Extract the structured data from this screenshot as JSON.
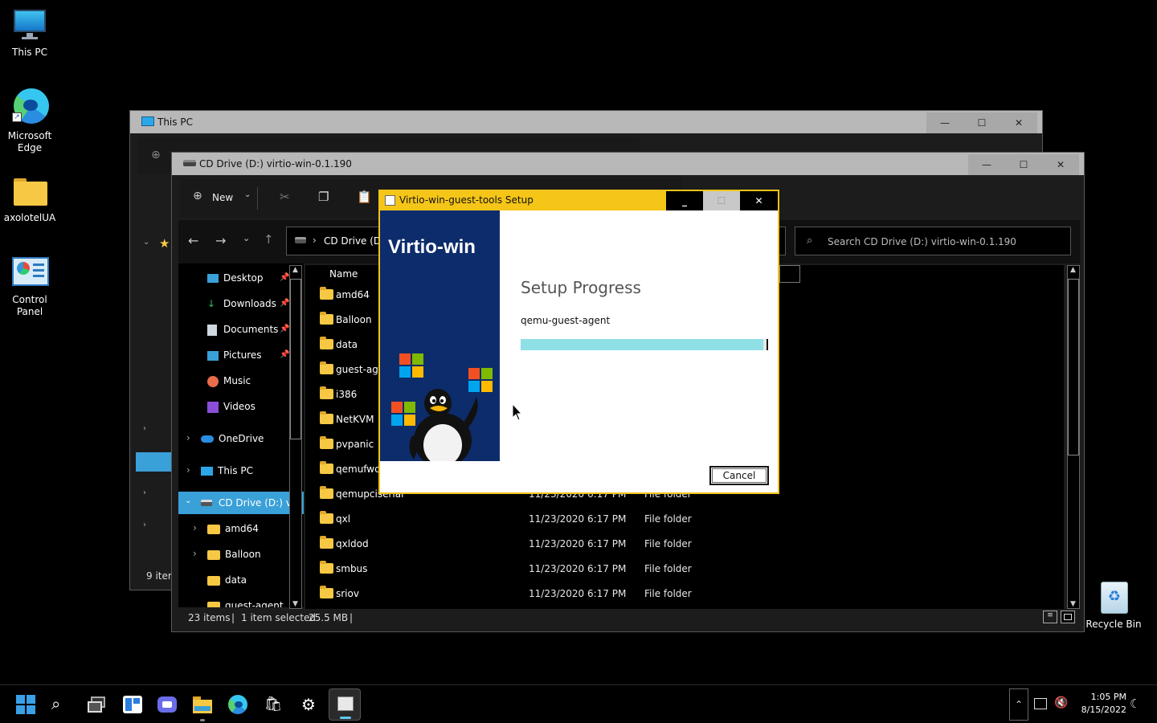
{
  "desktop": {
    "icons": [
      {
        "label": "This PC",
        "icon": "monitor-icon"
      },
      {
        "label": "Microsoft Edge",
        "icon": "edge-icon"
      },
      {
        "label": "axolotelUA",
        "icon": "folder-icon"
      },
      {
        "label": "Control Panel",
        "icon": "control-panel-icon"
      },
      {
        "label": "Recycle Bin",
        "icon": "recycle-bin-icon"
      }
    ]
  },
  "back_window": {
    "title": "This PC",
    "status": "9 item"
  },
  "explorer": {
    "title": "CD Drive (D:) virtio-win-0.1.190",
    "toolbar": {
      "new_label": "New"
    },
    "address": {
      "crumb": "CD Drive (D:)"
    },
    "search": {
      "placeholder": "Search CD Drive (D:) virtio-win-0.1.190"
    },
    "nav": {
      "quick_access": [
        {
          "label": "Desktop"
        },
        {
          "label": "Downloads"
        },
        {
          "label": "Documents"
        },
        {
          "label": "Pictures"
        },
        {
          "label": "Music"
        },
        {
          "label": "Videos"
        }
      ],
      "onedrive": "OneDrive",
      "this_pc": "This PC",
      "cd_drive": "CD Drive (D:) virt",
      "subfolders": [
        "amd64",
        "Balloon",
        "data",
        "guest-agent"
      ]
    },
    "column_name": "Name",
    "files": [
      {
        "name": "amd64",
        "date": "",
        "type": ""
      },
      {
        "name": "Balloon",
        "date": "",
        "type": ""
      },
      {
        "name": "data",
        "date": "",
        "type": ""
      },
      {
        "name": "guest-age",
        "date": "",
        "type": ""
      },
      {
        "name": "i386",
        "date": "",
        "type": ""
      },
      {
        "name": "NetKVM",
        "date": "",
        "type": ""
      },
      {
        "name": "pvpanic",
        "date": "",
        "type": ""
      },
      {
        "name": "qemufwc",
        "date": "",
        "type": ""
      },
      {
        "name": "qemupciserial",
        "date": "11/23/2020 6:17 PM",
        "type": "File folder"
      },
      {
        "name": "qxl",
        "date": "11/23/2020 6:17 PM",
        "type": "File folder"
      },
      {
        "name": "qxldod",
        "date": "11/23/2020 6:17 PM",
        "type": "File folder"
      },
      {
        "name": "smbus",
        "date": "11/23/2020 6:17 PM",
        "type": "File folder"
      },
      {
        "name": "sriov",
        "date": "11/23/2020 6:17 PM",
        "type": "File folder"
      }
    ],
    "status": {
      "items": "23 items",
      "selected": "1 item selected",
      "size": "25.5 MB"
    }
  },
  "setup": {
    "title": "Virtio-win-guest-tools Setup",
    "brand": "Virtio-win",
    "heading": "Setup Progress",
    "current_item": "qemu-guest-agent",
    "progress": 0.98,
    "cancel_label": "Cancel",
    "colors": {
      "title_bar": "#f5c518",
      "banner": "#0d2c6b",
      "progress": "#8fdfe6"
    }
  },
  "taskbar": {
    "time": "1:05 PM",
    "date": "8/15/2022",
    "icons": [
      "start-icon",
      "search-icon",
      "task-view-icon",
      "widgets-icon",
      "chat-icon",
      "file-explorer-icon",
      "edge-icon",
      "store-icon",
      "settings-icon",
      "setup-app-icon"
    ]
  }
}
